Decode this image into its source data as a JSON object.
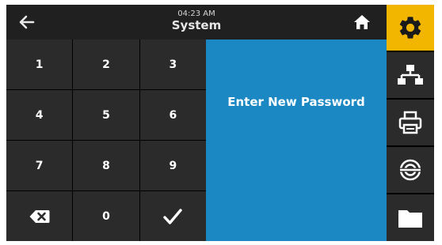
{
  "header": {
    "time": "04:23 AM",
    "title": "System",
    "back_icon": "back-arrow-icon",
    "home_icon": "home-icon"
  },
  "keypad": {
    "keys": [
      "1",
      "2",
      "3",
      "4",
      "5",
      "6",
      "7",
      "8",
      "9"
    ],
    "zero": "0",
    "backspace_icon": "backspace-icon",
    "confirm_icon": "checkmark-icon"
  },
  "panel": {
    "prompt": "Enter New Password"
  },
  "sidebar": {
    "items": [
      {
        "icon": "gear-icon",
        "active": true
      },
      {
        "icon": "network-icon",
        "active": false
      },
      {
        "icon": "printer-icon",
        "active": false
      },
      {
        "icon": "rfid-icon",
        "active": false
      },
      {
        "icon": "folder-icon",
        "active": false
      }
    ]
  },
  "colors": {
    "accent": "#f2b600",
    "panel": "#1b88c4",
    "key": "#2b2b2b",
    "background": "#161616"
  }
}
